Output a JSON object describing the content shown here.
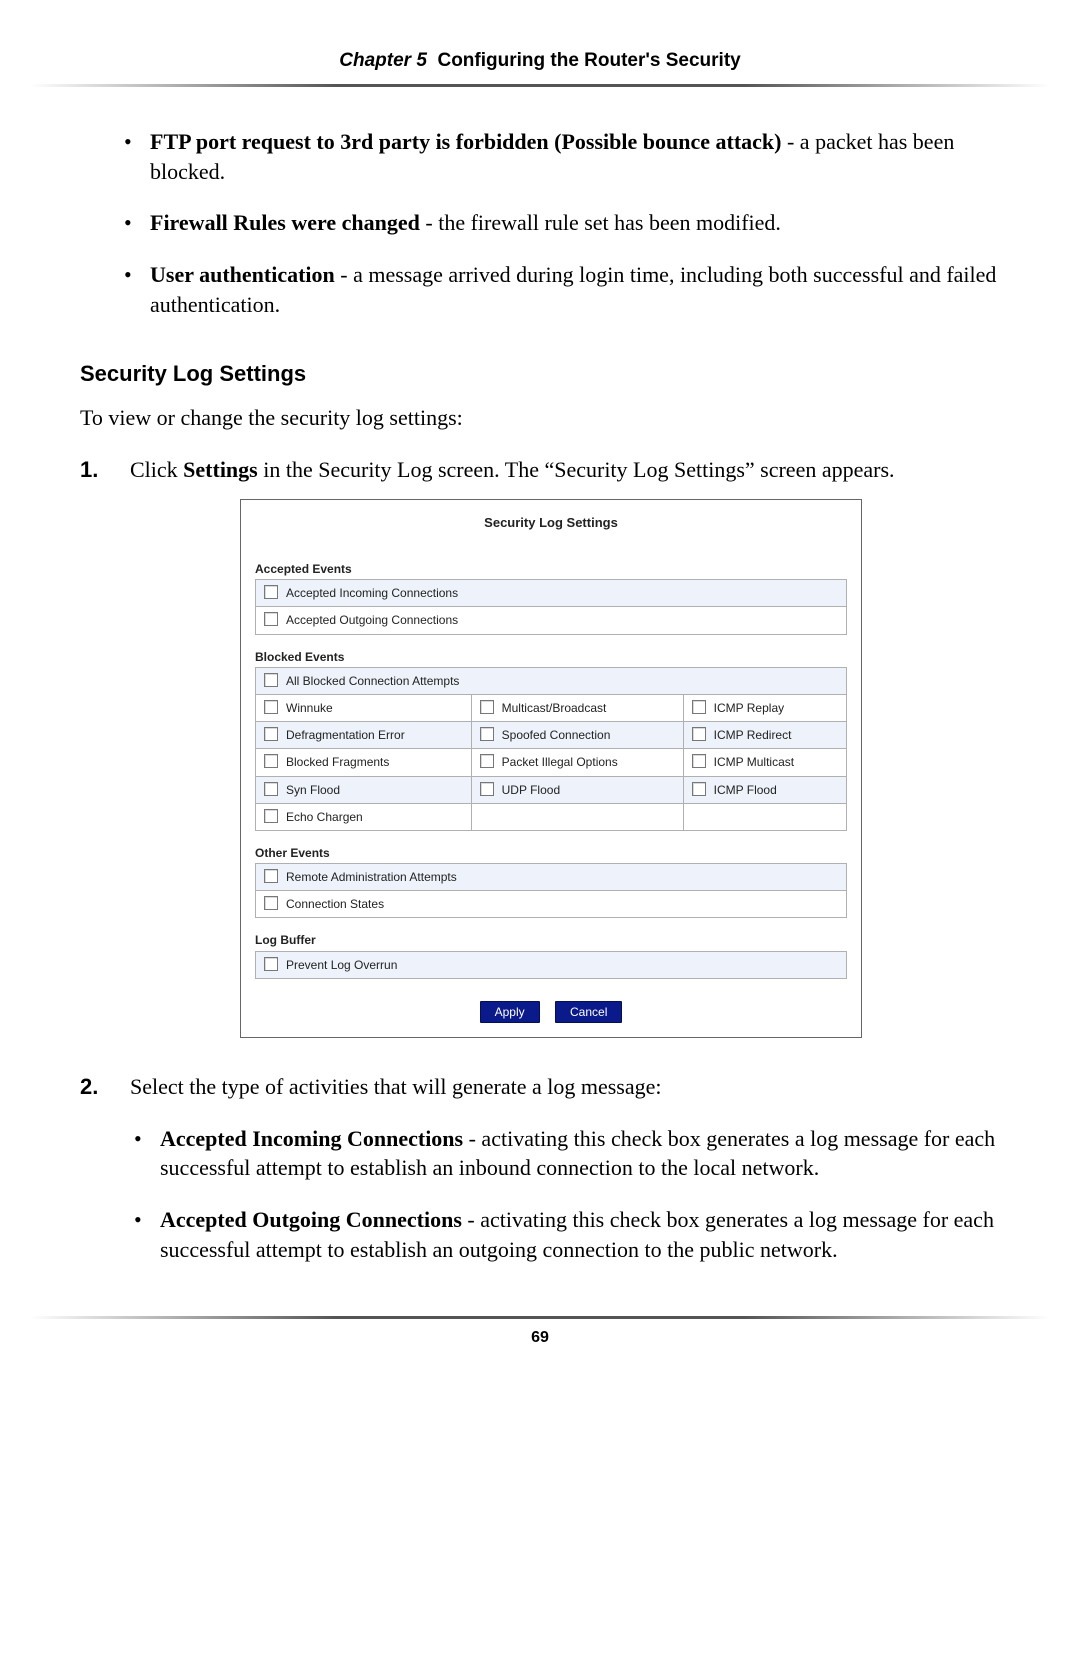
{
  "header": {
    "chapter": "Chapter 5",
    "title": "Configuring the Router's Security"
  },
  "intro_bullets": [
    {
      "bold": "FTP port request to 3rd party is forbidden (Possible bounce attack)",
      "rest": " - a packet has been blocked."
    },
    {
      "bold": "Firewall Rules were changed",
      "rest": " - the firewall rule set has been modified."
    },
    {
      "bold": "User authentication",
      "rest": " - a message arrived during login time, including both successful and failed authentication."
    }
  ],
  "section_heading": "Security Log Settings",
  "section_intro": "To view or change the security log settings:",
  "step1": {
    "pre": "Click ",
    "bold": "Settings",
    "post": " in the Security Log screen. The “Security Log Settings” screen appears."
  },
  "panel": {
    "title": "Security Log Settings",
    "accepted_heading": "Accepted Events",
    "accepted": [
      "Accepted Incoming Connections",
      "Accepted Outgoing Connections"
    ],
    "blocked_heading": "Blocked Events",
    "blocked_top": "All Blocked Connection Attempts",
    "blocked_grid": [
      [
        "Winnuke",
        "Multicast/Broadcast",
        "ICMP Replay"
      ],
      [
        "Defragmentation Error",
        "Spoofed Connection",
        "ICMP Redirect"
      ],
      [
        "Blocked Fragments",
        "Packet Illegal Options",
        "ICMP Multicast"
      ],
      [
        "Syn Flood",
        "UDP Flood",
        "ICMP Flood"
      ],
      [
        "Echo Chargen",
        "",
        ""
      ]
    ],
    "other_heading": "Other Events",
    "other": [
      "Remote Administration Attempts",
      "Connection States"
    ],
    "buffer_heading": "Log Buffer",
    "buffer": [
      "Prevent Log Overrun"
    ],
    "buttons": {
      "apply": "Apply",
      "cancel": "Cancel"
    }
  },
  "step2": {
    "text": "Select the type of activities that will generate a log message:",
    "subs": [
      {
        "bold": "Accepted Incoming Connections",
        "rest": " - activating this check box generates a log message for each successful attempt to establish an inbound connection to the local network."
      },
      {
        "bold": "Accepted Outgoing Connections",
        "rest": " - activating this check box generates a log message for each successful attempt to establish an outgoing connection to the public network."
      }
    ]
  },
  "page_number": "69"
}
